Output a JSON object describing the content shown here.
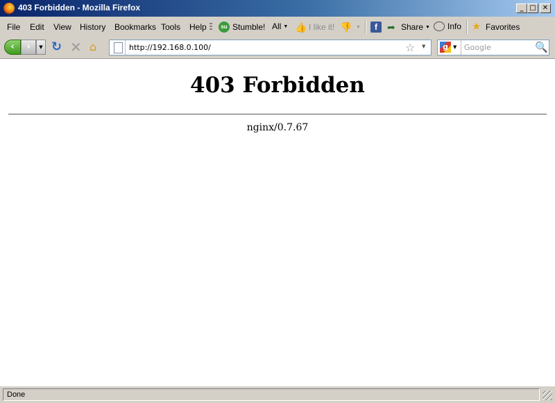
{
  "window": {
    "title": "403 Forbidden - Mozilla Firefox",
    "minimize": "_",
    "maximize": "□",
    "close": "✕"
  },
  "menu": [
    "File",
    "Edit",
    "View",
    "History",
    "Bookmarks",
    "Tools",
    "Help"
  ],
  "toolbar": {
    "stumble": "Stumble!",
    "all": "All",
    "ilike": "I like it!",
    "share": "Share",
    "info": "Info",
    "favorites": "Favorites"
  },
  "nav": {
    "url": "http://192.168.0.100/",
    "search_engine_icon": "g",
    "search_placeholder": "Google"
  },
  "page": {
    "heading": "403 Forbidden",
    "server": "nginx/0.7.67"
  },
  "status": {
    "text": "Done"
  },
  "icons": {
    "back": "back-arrow-icon",
    "forward": "forward-arrow-icon",
    "reload": "reload-icon",
    "stop": "stop-icon",
    "home": "home-icon"
  }
}
